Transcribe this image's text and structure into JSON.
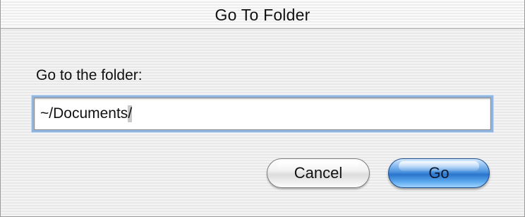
{
  "window": {
    "title": "Go To Folder"
  },
  "dialog": {
    "prompt_label": "Go to the folder:",
    "path_field": {
      "value_prefix": "~/Documents",
      "value_selected": "/"
    },
    "buttons": {
      "cancel_label": "Cancel",
      "go_label": "Go"
    }
  },
  "colors": {
    "default_button": "#2a74cc",
    "focus_ring": "#8fb5e0",
    "selection": "#c9c9c9"
  }
}
